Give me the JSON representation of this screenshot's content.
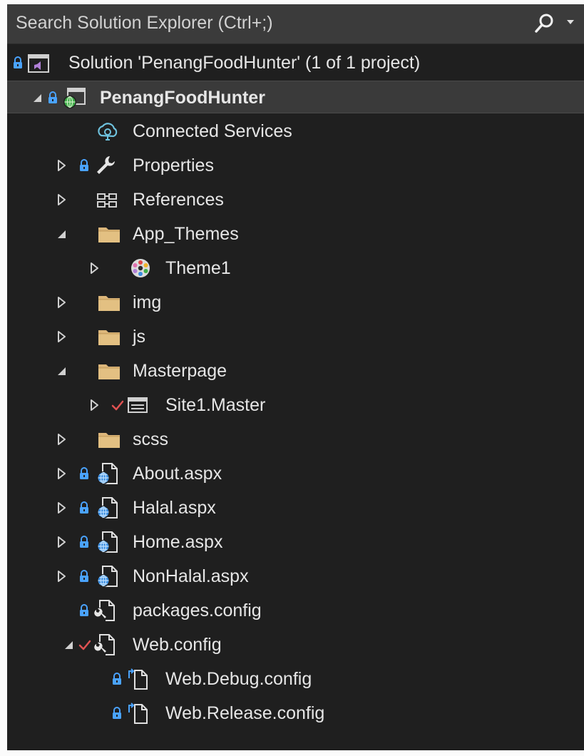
{
  "search": {
    "placeholder": "Search Solution Explorer (Ctrl+;)"
  },
  "tree": {
    "solution": "Solution 'PenangFoodHunter' (1 of 1 project)",
    "project": "PenangFoodHunter",
    "connected_services": "Connected Services",
    "properties": "Properties",
    "references": "References",
    "app_themes": "App_Themes",
    "theme1": "Theme1",
    "img": "img",
    "js": "js",
    "masterpage": "Masterpage",
    "site1_master": "Site1.Master",
    "scss": "scss",
    "about": "About.aspx",
    "halal": "Halal.aspx",
    "home": "Home.aspx",
    "nonhalal": "NonHalal.aspx",
    "packages_config": "packages.config",
    "web_config": "Web.config",
    "web_debug_config": "Web.Debug.config",
    "web_release_config": "Web.Release.config"
  },
  "colors": {
    "background": "#1f1f1f",
    "search_background": "#3b3b3b",
    "selected_row": "#3a3a3a",
    "lock_blue": "#4aa3ff",
    "folder": "#dcb67a",
    "check_red": "#e05252",
    "text": "#e6e6e6"
  }
}
